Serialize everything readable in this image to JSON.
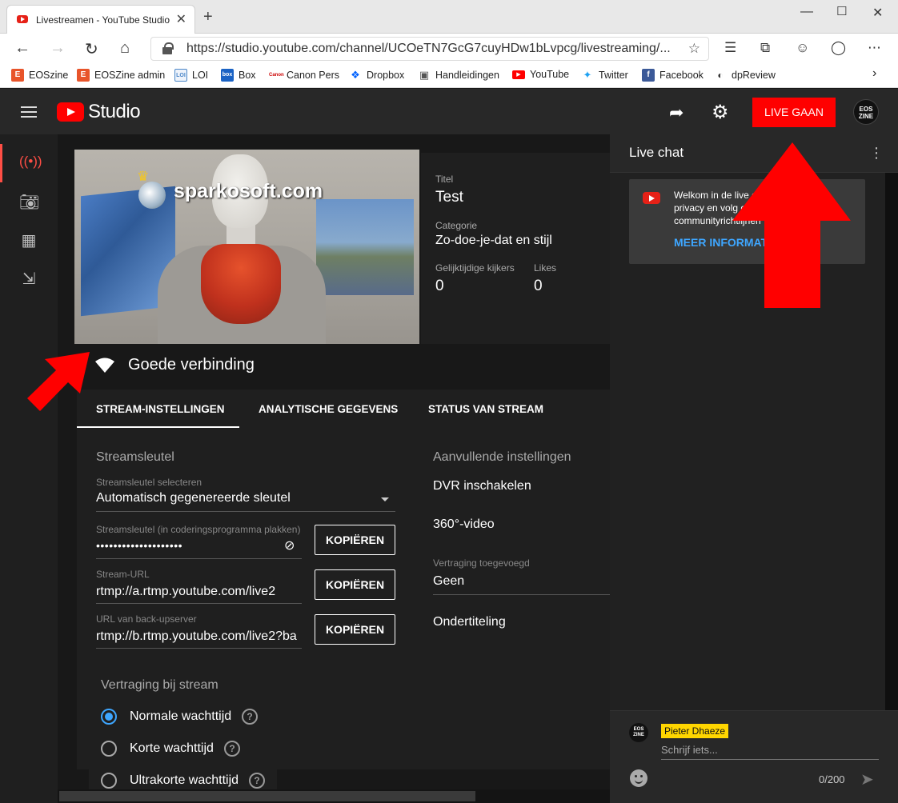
{
  "browser": {
    "tab_title": "Livestreamen - YouTube Studio",
    "url": "https://studio.youtube.com/channel/UCOeTN7GcG7cuyHDw1bLvpcg/livestreaming/...",
    "bookmarks": [
      {
        "label": "EOSzine",
        "color": "#e8542a"
      },
      {
        "label": "EOSZine admin",
        "color": "#e8542a"
      },
      {
        "label": "LOI",
        "color": "#4a86c8"
      },
      {
        "label": "Box",
        "color": "#1a62c4"
      },
      {
        "label": "Canon Pers",
        "color": "#cc0000"
      },
      {
        "label": "Dropbox",
        "color": "#0061fe"
      },
      {
        "label": "Handleidingen",
        "color": "#555555"
      },
      {
        "label": "YouTube",
        "color": "#ff0000"
      },
      {
        "label": "Twitter",
        "color": "#1da1f2"
      },
      {
        "label": "Facebook",
        "color": "#3b5998"
      },
      {
        "label": "dpReview",
        "color": "#333333"
      }
    ]
  },
  "header": {
    "studio_label": "Studio",
    "live_button": "LIVE GAAN",
    "avatar_text": "EOS ZINE"
  },
  "stream": {
    "watermark": "sparkosoft.com",
    "title_label": "Titel",
    "title": "Test",
    "category_label": "Categorie",
    "category": "Zo-doe-je-dat en stijl",
    "viewers_label": "Gelijktijdige kijkers",
    "viewers": "0",
    "likes_label": "Likes",
    "likes": "0",
    "connection": "Goede verbinding"
  },
  "tabs": [
    "STREAM-INSTELLINGEN",
    "ANALYTISCHE GEGEVENS",
    "STATUS VAN STREAM"
  ],
  "settings": {
    "key_section": "Streamsleutel",
    "key_select_label": "Streamsleutel selecteren",
    "key_select_value": "Automatisch gegenereerde sleutel",
    "key_label": "Streamsleutel (in coderingsprogramma plakken)",
    "key_value": "••••••••••••••••••••",
    "url_label": "Stream-URL",
    "url_value": "rtmp://a.rtmp.youtube.com/live2",
    "backup_label": "URL van back-upserver",
    "backup_value": "rtmp://b.rtmp.youtube.com/live2?ba",
    "copy_label": "KOPIËREN",
    "extra_section": "Aanvullende instellingen",
    "dvr": "DVR inschakelen",
    "video360": "360°-video",
    "delay_added_label": "Vertraging toegevoegd",
    "delay_added_value": "Geen",
    "subtitles": "Ondertiteling",
    "latency_section": "Vertraging bij stream",
    "latency_options": [
      "Normale wachttijd",
      "Korte wachttijd",
      "Ultrakorte wachttijd"
    ],
    "latency_selected": 0
  },
  "chat": {
    "title": "Live chat",
    "welcome_lines": [
      "Welkom in de live c",
      "privacy en volg o",
      "communityrichtlijnen"
    ],
    "more_info": "MEER INFORMAT",
    "user_name": "Pieter Dhaeze",
    "input_placeholder": "Schrijf iets...",
    "char_count": "0/200"
  }
}
